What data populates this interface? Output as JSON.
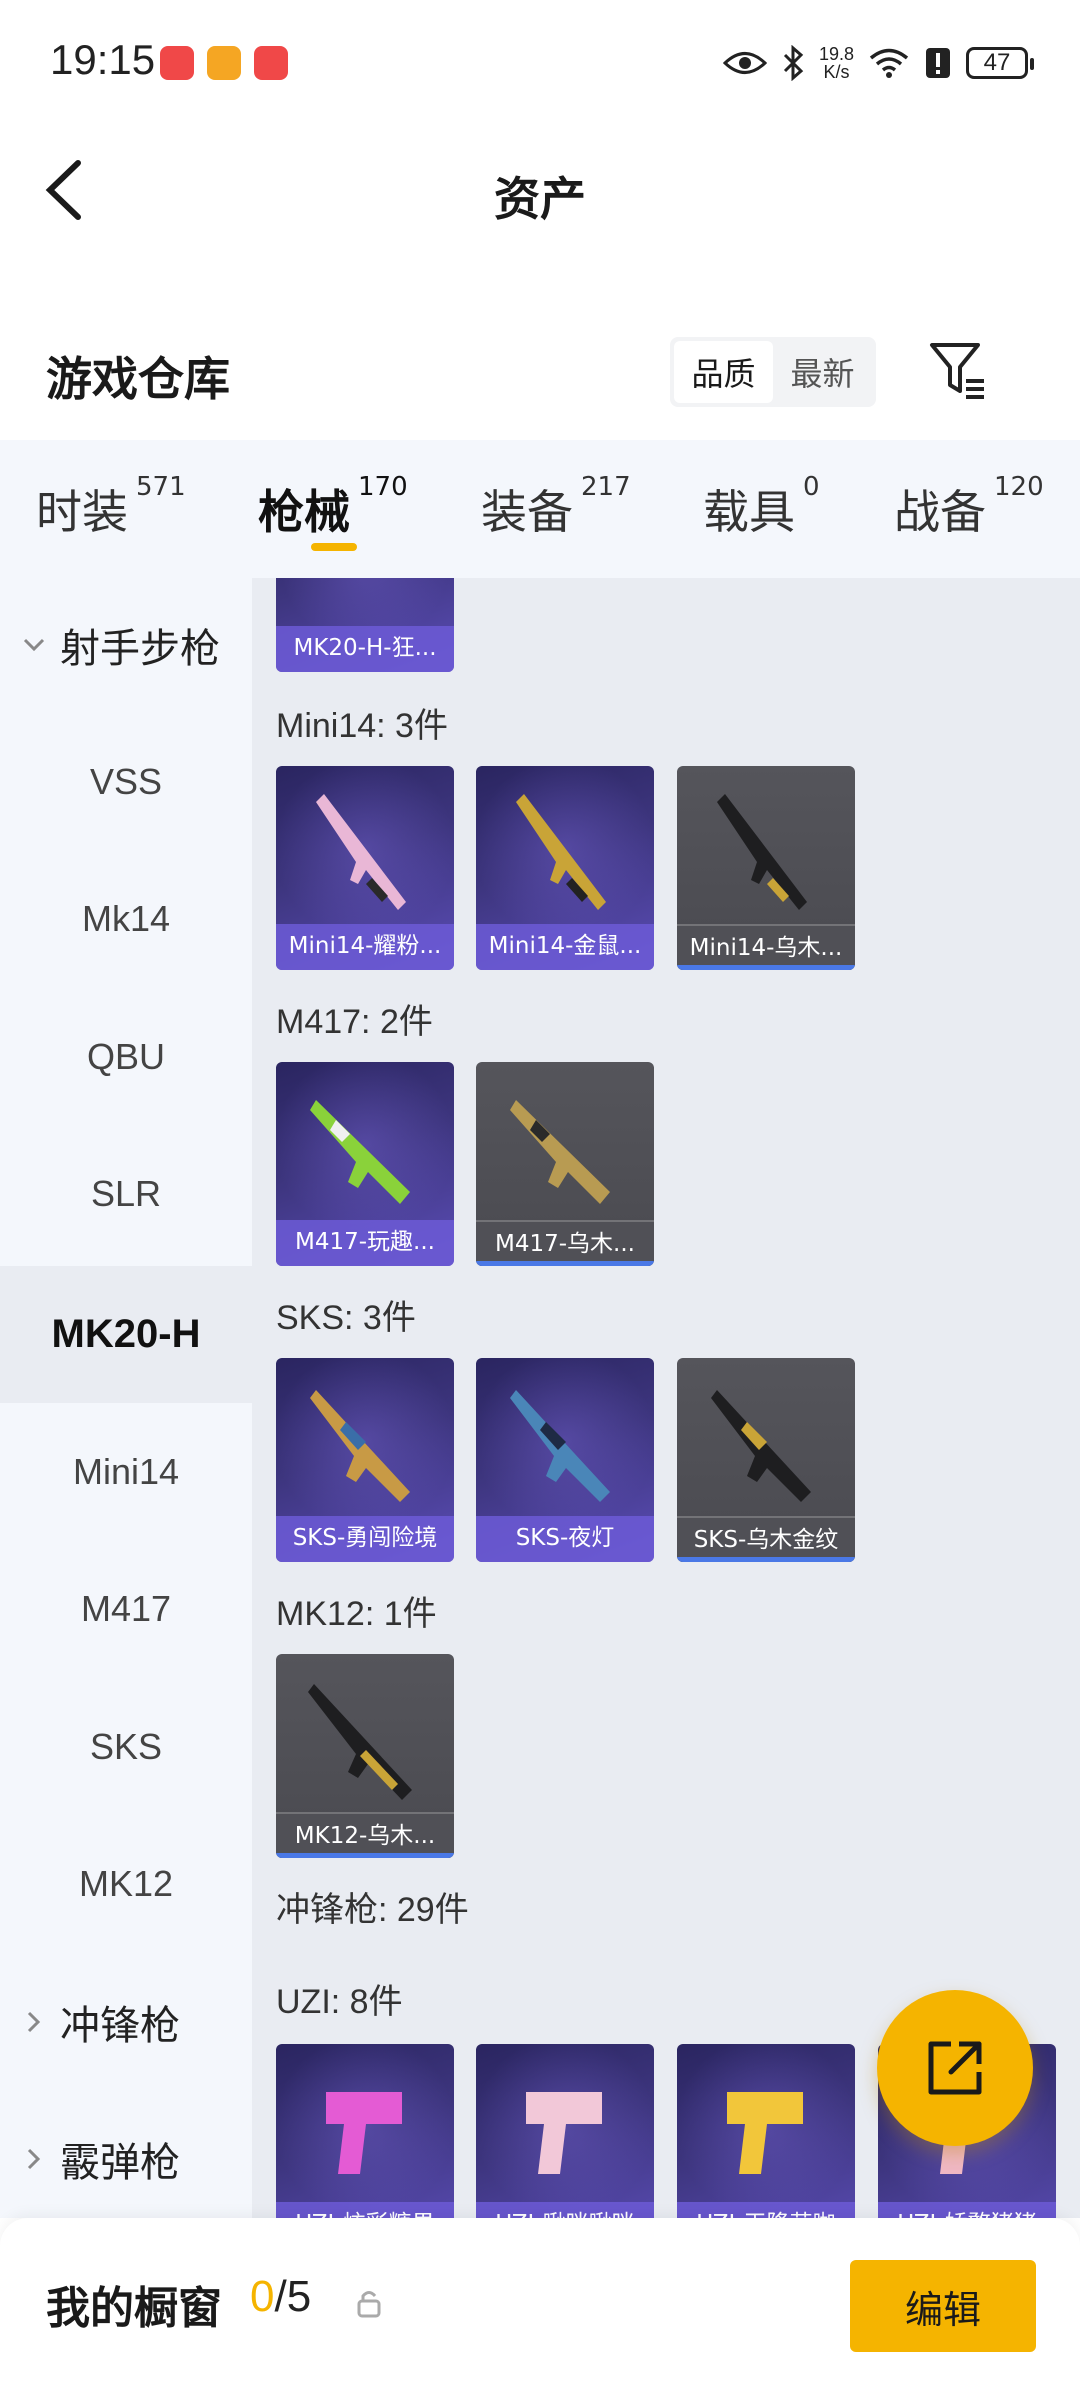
{
  "status_bar": {
    "time": "19:15",
    "net_speed_value": "19.8",
    "net_speed_unit": "K/s",
    "battery": "47"
  },
  "header": {
    "title": "资产"
  },
  "warehouse": {
    "title": "游戏仓库",
    "sort_options": [
      "品质",
      "最新"
    ],
    "active_sort": "品质"
  },
  "tabs": [
    {
      "label": "时装",
      "count": "571"
    },
    {
      "label": "枪械",
      "count": "170"
    },
    {
      "label": "装备",
      "count": "217"
    },
    {
      "label": "载具",
      "count": "0"
    },
    {
      "label": "战备",
      "count": "120"
    }
  ],
  "sidebar": {
    "group_open": "射手步枪",
    "items": [
      "VSS",
      "Mk14",
      "QBU",
      "SLR",
      "MK20-H",
      "Mini14",
      "M417",
      "SKS",
      "MK12"
    ],
    "active_item": "MK20-H",
    "groups_closed": [
      "冲锋枪",
      "霰弹枪"
    ]
  },
  "content": {
    "partial_card_label": "MK20-H-狂...",
    "sections": [
      {
        "title": "Mini14: 3件",
        "cards": [
          {
            "label": "Mini14-耀粉...",
            "rarity": "epic"
          },
          {
            "label": "Mini14-金鼠...",
            "rarity": "epic"
          },
          {
            "label": "Mini14-乌木...",
            "rarity": "rare"
          }
        ]
      },
      {
        "title": "M417: 2件",
        "cards": [
          {
            "label": "M417-玩趣...",
            "rarity": "epic"
          },
          {
            "label": "M417-乌木...",
            "rarity": "rare"
          }
        ]
      },
      {
        "title": "SKS: 3件",
        "cards": [
          {
            "label": "SKS-勇闯险境",
            "rarity": "epic"
          },
          {
            "label": "SKS-夜灯",
            "rarity": "epic"
          },
          {
            "label": "SKS-乌木金纹",
            "rarity": "rare"
          }
        ]
      },
      {
        "title": "MK12: 1件",
        "cards": [
          {
            "label": "MK12-乌木...",
            "rarity": "rare"
          }
        ]
      }
    ],
    "category_title": "冲锋枪: 29件",
    "uzi_title": "UZI: 8件",
    "uzi_cards": [
      "UZI-炫彩糖果",
      "UZI-啾咪啾咪",
      "UZI-天降萌咖",
      "UZI-娇憨猪猪"
    ]
  },
  "bottom_bar": {
    "title": "我的橱窗",
    "current": "0",
    "total": "/5",
    "edit_label": "编辑"
  },
  "colors": {
    "accent": "#f5b400",
    "epic_card": "#3d357e",
    "rare_card": "#4a4a50",
    "rare_bar": "#4a78e6"
  }
}
